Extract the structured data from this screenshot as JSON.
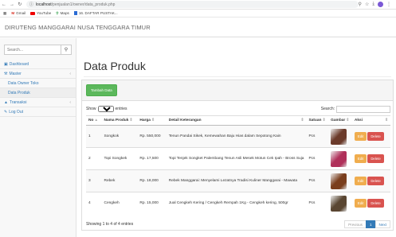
{
  "browser": {
    "url_host": "localhost",
    "url_path": "/penjualan1/owner/data_produk.php",
    "bookmarks": [
      "Gmail",
      "YouTube",
      "Maps",
      "16. DAFTAR PUSTAK..."
    ]
  },
  "site": {
    "title": "DIRUTENG MANGGARAI NUSA TENGGARA TIMUR"
  },
  "sidebar": {
    "search_placeholder": "Search...",
    "items": [
      {
        "label": "Dashboard"
      },
      {
        "label": "Master"
      },
      {
        "label": "Data Owner Toko"
      },
      {
        "label": "Data Produk"
      },
      {
        "label": "Transaksi"
      },
      {
        "label": "Log Out"
      }
    ]
  },
  "main": {
    "title": "Data Produk",
    "add_button": "Tambah Data",
    "show_label": "Show",
    "entries_value": "10",
    "entries_label": "entries",
    "search_label": "Search:",
    "columns": [
      "No",
      "Nama Produk",
      "Harga",
      "Detail Keterangan",
      "Satuan",
      "Gambar",
      "Aksi"
    ],
    "rows": [
      {
        "no": "1",
        "nama": "Songkok",
        "harga": "Rp. 550,000",
        "detail": "Tenun Pandai Sikek, Kemewahan Baju Hias dalam Sepotong Kain",
        "satuan": "Pcs",
        "img_color": "#6b3a2a"
      },
      {
        "no": "2",
        "nama": "Topi Songkek",
        "harga": "Rp. 17,500",
        "detail": "Topi Tenjek Songket Palembang Tenun Asli Mesek Motun Cek Ipah - Bross Suja",
        "satuan": "Pcs",
        "img_color": "#b0305a"
      },
      {
        "no": "3",
        "nama": "Rebek",
        "harga": "Rp. 18,000",
        "detail": "Rebek Manggarai: Menyelami Lezatnya Tradisi Kuliner Manggarai - Mawata",
        "satuan": "Pcs",
        "img_color": "#7a3e1d"
      },
      {
        "no": "4",
        "nama": "Cengkeh",
        "harga": "Rp. 15,000",
        "detail": "Jual Cengkeh Kering / Cengkeh Rempah 1Kg - Cengkeh kering, 500gr",
        "satuan": "Pcs",
        "img_color": "#5a4632"
      }
    ],
    "edit_label": "Edit",
    "delete_label": "Delete",
    "footer_info": "Showing 1 to 4 of 4 entries",
    "pager": {
      "prev": "Previous",
      "current": "1",
      "next": "Next"
    }
  }
}
